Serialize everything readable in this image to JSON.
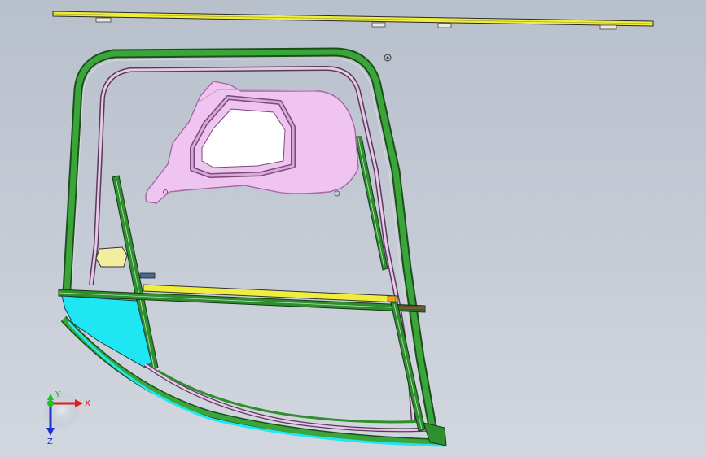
{
  "viewport": {
    "background_top": "#b8c0cc",
    "background_bottom": "#d2d7df"
  },
  "colors": {
    "frame_green": "#2f8f2f",
    "frame_dark": "#1c4f1c",
    "panel_pink": "#f0c4f0",
    "panel_edge": "#a268a2",
    "glass_white": "#ffffff",
    "rail_yellow": "#f0ee3c",
    "cyan_panel": "#1ee6f2",
    "small_pad": "#f2eea0",
    "accent_orange": "#f0a020"
  },
  "triad": {
    "x_label": "X",
    "y_label": "Y",
    "z_label": "Z",
    "x_color": "#e02020",
    "y_color": "#20c020",
    "z_color": "#2030d0"
  },
  "icons": [
    "origin-marker-icon",
    "axis-triad-icon"
  ]
}
